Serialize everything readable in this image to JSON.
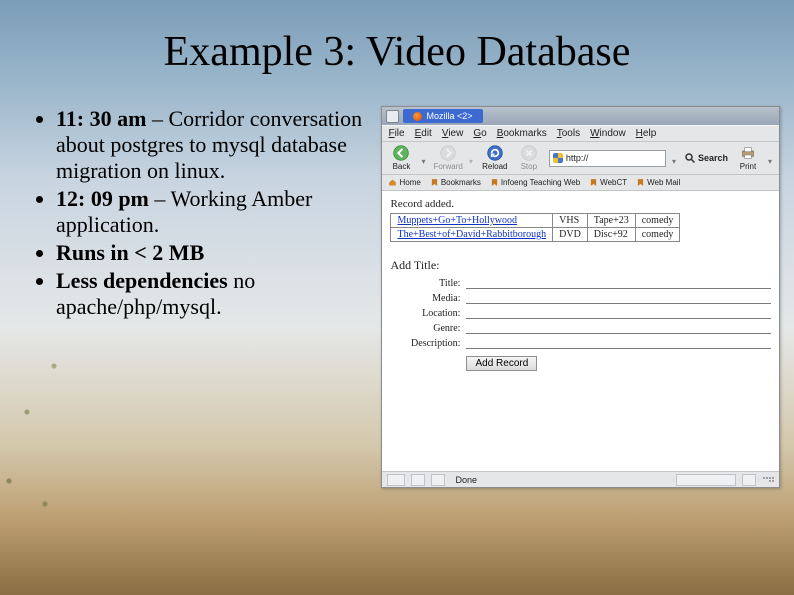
{
  "title": "Example 3: Video Database",
  "bullets": [
    {
      "bold": "11: 30 am",
      "rest": " – Corridor conversation about postgres to mysql database migration on linux."
    },
    {
      "bold": "12: 09 pm",
      "rest": " – Working Amber application."
    },
    {
      "bold": "Runs in < 2 MB",
      "rest": ""
    },
    {
      "bold": "Less dependencies",
      "rest": " no apache/php/mysql."
    }
  ],
  "browser": {
    "window_title": "Mozilla <2>",
    "menus": [
      "File",
      "Edit",
      "View",
      "Go",
      "Bookmarks",
      "Tools",
      "Window",
      "Help"
    ],
    "toolbar": {
      "back": "Back",
      "forward": "Forward",
      "reload": "Reload",
      "stop": "Stop",
      "url": "http://",
      "search": "Search",
      "print": "Print"
    },
    "bookmarks": [
      "Home",
      "Bookmarks",
      "Infoeng Teaching Web",
      "WebCT",
      "Web Mail"
    ],
    "page": {
      "record_added": "Record added.",
      "table": {
        "rows": [
          {
            "title": "Muppets+Go+To+Hollywood",
            "media": "VHS",
            "location": "Tape+23",
            "genre": "comedy"
          },
          {
            "title": "The+Best+of+David+Rabbitborough",
            "media": "DVD",
            "location": "Disc+92",
            "genre": "comedy"
          }
        ]
      },
      "add_title": "Add Title:",
      "form_labels": {
        "title": "Title:",
        "media": "Media:",
        "location": "Location:",
        "genre": "Genre:",
        "description": "Description:"
      },
      "button": "Add Record"
    },
    "status": "Done"
  }
}
